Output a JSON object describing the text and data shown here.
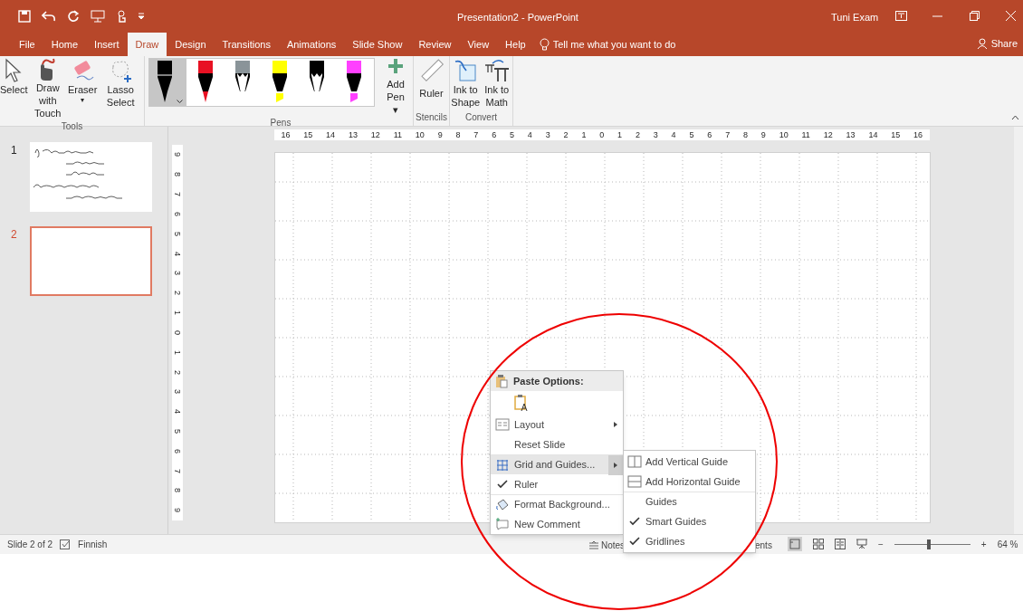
{
  "window": {
    "title": "Presentation2  -  PowerPoint",
    "user": "Tuni Exam"
  },
  "tabs": [
    {
      "label": "File",
      "selected": false
    },
    {
      "label": "Home",
      "selected": false
    },
    {
      "label": "Insert",
      "selected": false
    },
    {
      "label": "Draw",
      "selected": true
    },
    {
      "label": "Design",
      "selected": false
    },
    {
      "label": "Transitions",
      "selected": false
    },
    {
      "label": "Animations",
      "selected": false
    },
    {
      "label": "Slide Show",
      "selected": false
    },
    {
      "label": "Review",
      "selected": false
    },
    {
      "label": "View",
      "selected": false
    },
    {
      "label": "Help",
      "selected": false
    }
  ],
  "tell_me": "Tell me what you want to do",
  "share": "Share",
  "ribbon": {
    "tools": {
      "label": "Tools",
      "items": [
        {
          "kind": "select",
          "label": "Select"
        },
        {
          "kind": "touch",
          "label": "Draw with Touch"
        },
        {
          "kind": "eraser",
          "label": "Eraser",
          "dropdown": "▾"
        },
        {
          "kind": "lasso",
          "label": "Lasso Select"
        }
      ]
    },
    "pens": {
      "label": "Pens",
      "items": [
        {
          "kind": "pen",
          "color": "#000000",
          "selected": true
        },
        {
          "kind": "pen",
          "color": "#e81123",
          "selected": false
        },
        {
          "kind": "pencil",
          "color": "#8a9499",
          "selected": false
        },
        {
          "kind": "highlighter",
          "color": "#ffff00",
          "selected": false
        },
        {
          "kind": "pencil",
          "color": "#000000",
          "selected": false
        },
        {
          "kind": "highlighter",
          "color": "#ff40ff",
          "selected": false
        }
      ],
      "add": "Add Pen",
      "add_dropdown": "▾"
    },
    "stencils": {
      "label": "Stencils",
      "item": "Ruler"
    },
    "convert": {
      "label": "Convert",
      "items": [
        {
          "kind": "shape",
          "label": "Ink to Shape"
        },
        {
          "kind": "math",
          "label": "Ink to Math"
        }
      ]
    }
  },
  "slides": [
    {
      "number": "1",
      "selected": false,
      "kind": "ink"
    },
    {
      "number": "2",
      "selected": true,
      "kind": "blank"
    }
  ],
  "ruler": {
    "horizontal": [
      "16",
      "15",
      "14",
      "13",
      "12",
      "11",
      "10",
      "9",
      "8",
      "7",
      "6",
      "5",
      "4",
      "3",
      "2",
      "1",
      "0",
      "1",
      "2",
      "3",
      "4",
      "5",
      "6",
      "7",
      "8",
      "9",
      "10",
      "11",
      "12",
      "13",
      "14",
      "15",
      "16"
    ],
    "vertical": [
      "9",
      "8",
      "7",
      "6",
      "5",
      "4",
      "3",
      "2",
      "1",
      "0",
      "1",
      "2",
      "3",
      "4",
      "5",
      "6",
      "7",
      "8",
      "9"
    ]
  },
  "context_menu": {
    "paste_title": "Paste Options:",
    "items": [
      {
        "kind": "layout",
        "label": "Layout",
        "submenu": true,
        "checked": false,
        "selected": false
      },
      {
        "kind": "plain",
        "label": "Reset Slide",
        "submenu": false,
        "checked": false,
        "selected": false
      },
      {
        "kind": "grid",
        "label": "Grid and Guides...",
        "submenu": true,
        "checked": false,
        "selected": true
      },
      {
        "kind": "plain",
        "label": "Ruler",
        "submenu": false,
        "checked": true,
        "selected": false
      },
      {
        "kind": "background",
        "label": "Format Background...",
        "submenu": false,
        "checked": false,
        "selected": false
      },
      {
        "kind": "comment",
        "label": "New Comment",
        "submenu": false,
        "checked": false,
        "selected": false
      }
    ]
  },
  "submenu": [
    {
      "kind": "vertical",
      "label": "Add Vertical Guide",
      "checked": false
    },
    {
      "kind": "horizontal",
      "label": "Add Horizontal Guide",
      "checked": false
    },
    {
      "kind": "plain",
      "label": "Guides",
      "checked": false
    },
    {
      "kind": "plain",
      "label": "Smart Guides",
      "checked": true
    },
    {
      "kind": "plain",
      "label": "Gridlines",
      "checked": true
    }
  ],
  "status_bar": {
    "slide": "Slide 2 of 2",
    "language": "Finnish",
    "notes": "Notes",
    "comments": "ents",
    "zoom": "64 %",
    "zoom_slider": {
      "level": 0.45
    },
    "minus": "−",
    "plus": "+"
  }
}
